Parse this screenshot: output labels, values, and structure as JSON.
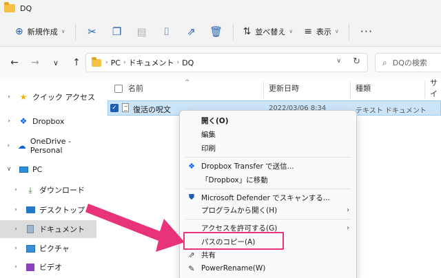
{
  "window": {
    "title": "DQ"
  },
  "toolbar": {
    "new_label": "新規作成",
    "sort_label": "並べ替え",
    "view_label": "表示",
    "more_label": "···"
  },
  "address": {
    "crumbs": [
      "PC",
      "ドキュメント",
      "DQ"
    ],
    "search_placeholder": "DQの検索"
  },
  "nav": {
    "items": [
      {
        "label": "クイック アクセス"
      },
      {
        "label": "Dropbox"
      },
      {
        "label": "OneDrive - Personal"
      },
      {
        "label": "PC"
      },
      {
        "label": "ダウンロード"
      },
      {
        "label": "デスクトップ"
      },
      {
        "label": "ドキュメント"
      },
      {
        "label": "ピクチャ"
      },
      {
        "label": "ビデオ"
      }
    ]
  },
  "columns": {
    "name": "名前",
    "date": "更新日時",
    "type": "種類",
    "size": "サイ"
  },
  "files": [
    {
      "name": "復活の呪文",
      "date": "2022/03/06 8:34",
      "type": "テキスト ドキュメント"
    }
  ],
  "context_menu": {
    "items": [
      {
        "label": "開く(O)"
      },
      {
        "label": "編集"
      },
      {
        "label": "印刷"
      },
      {
        "label": "Dropbox Transfer で送信..."
      },
      {
        "label": "「Dropbox」に移動"
      },
      {
        "label": "Microsoft Defender でスキャンする..."
      },
      {
        "label": "プログラムから開く(H)"
      },
      {
        "label": "アクセスを許可する(G)"
      },
      {
        "label": "パスのコピー(A)"
      },
      {
        "label": "共有"
      },
      {
        "label": "PowerRename(W)"
      }
    ]
  },
  "colors": {
    "accent": "#1f5fb3",
    "annotation": "#e8327a",
    "selection": "#cce4f7"
  }
}
